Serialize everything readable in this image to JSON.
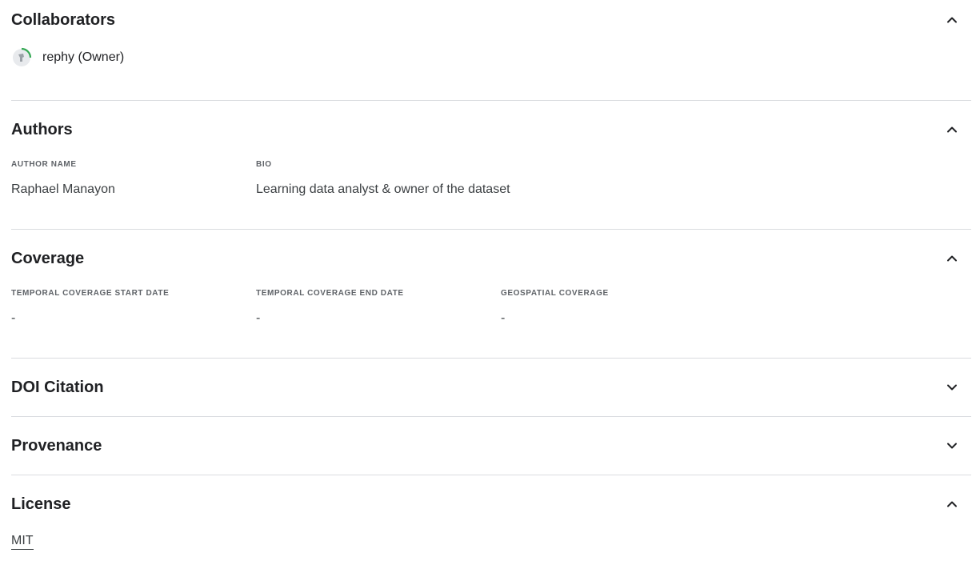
{
  "collaborators": {
    "title": "Collaborators",
    "items": [
      {
        "name": "rephy (Owner)"
      }
    ]
  },
  "authors": {
    "title": "Authors",
    "name_label": "AUTHOR NAME",
    "bio_label": "BIO",
    "rows": [
      {
        "name": "Raphael Manayon",
        "bio": "Learning data analyst & owner of the dataset"
      }
    ]
  },
  "coverage": {
    "title": "Coverage",
    "fields": [
      {
        "label": "TEMPORAL COVERAGE START DATE",
        "value": "-"
      },
      {
        "label": "TEMPORAL COVERAGE END DATE",
        "value": "-"
      },
      {
        "label": "GEOSPATIAL COVERAGE",
        "value": "-"
      }
    ]
  },
  "doi": {
    "title": "DOI Citation"
  },
  "provenance": {
    "title": "Provenance"
  },
  "license": {
    "title": "License",
    "value": "MIT"
  },
  "colors": {
    "text": "#202124",
    "muted": "#5f6368",
    "divider": "#dadce0",
    "avatar_ring": "#34a853"
  },
  "icons": {
    "expanded": "chevron-up-icon",
    "collapsed": "chevron-down-icon"
  }
}
